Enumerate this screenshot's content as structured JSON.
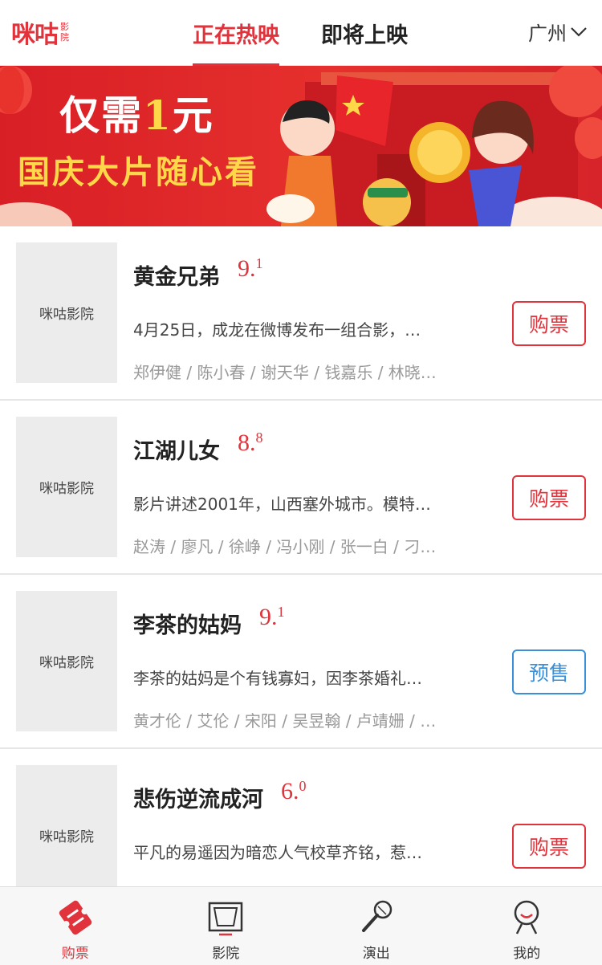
{
  "header": {
    "logo_main": "咪咕",
    "logo_sub1": "影",
    "logo_sub2": "院",
    "tabs": [
      {
        "label": "正在热映",
        "active": true
      },
      {
        "label": "即将上映",
        "active": false
      }
    ],
    "city": "广州"
  },
  "banner": {
    "line1_prefix": "仅需",
    "line1_num": "1",
    "line1_suffix": "元",
    "line2": "国庆大片随心看"
  },
  "movies": [
    {
      "poster": "咪咕影院",
      "title": "黄金兄弟",
      "score_int": "9.",
      "score_dec": "1",
      "desc": "4月25日，成龙在微博发布一组合影，…",
      "cast": "郑伊健 / 陈小春 / 谢天华 / 钱嘉乐 / 林晓…",
      "button": "购票",
      "button_type": "buy"
    },
    {
      "poster": "咪咕影院",
      "title": "江湖儿女",
      "score_int": "8.",
      "score_dec": "8",
      "desc": "影片讲述2001年，山西塞外城市。模特…",
      "cast": "赵涛 / 廖凡 / 徐峥 / 冯小刚 / 张一白 / 刁…",
      "button": "购票",
      "button_type": "buy"
    },
    {
      "poster": "咪咕影院",
      "title": "李茶的姑妈",
      "score_int": "9.",
      "score_dec": "1",
      "desc": "李茶的姑妈是个有钱寡妇，因李茶婚礼…",
      "cast": "黄才伦 / 艾伦 / 宋阳 / 吴昱翰 / 卢靖姗 / …",
      "button": "预售",
      "button_type": "presale"
    },
    {
      "poster": "咪咕影院",
      "title": "悲伤逆流成河",
      "score_int": "6.",
      "score_dec": "0",
      "desc": "平凡的易遥因为暗恋人气校草齐铭，惹…",
      "cast": "",
      "button": "购票",
      "button_type": "buy"
    }
  ],
  "bottom_nav": [
    {
      "label": "购票",
      "icon": "ticket-icon",
      "active": true
    },
    {
      "label": "影院",
      "icon": "cinema-screen-icon",
      "active": false
    },
    {
      "label": "演出",
      "icon": "microphone-icon",
      "active": false
    },
    {
      "label": "我的",
      "icon": "user-icon",
      "active": false
    }
  ],
  "colors": {
    "brand_red": "#e0333b",
    "presale_blue": "#3a8fd8"
  }
}
